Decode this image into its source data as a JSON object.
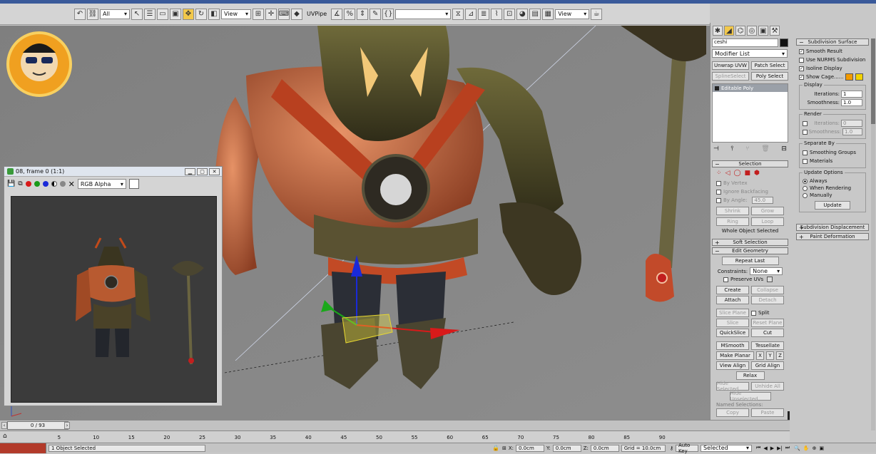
{
  "toolbar": {
    "filter_dropdown": "All",
    "refcoord_dropdown": "View",
    "uvpipe_label": "UVPipe",
    "view_dropdown": "View"
  },
  "render_window": {
    "title": "08, frame 0 (1:1)",
    "channel_dropdown": "RGB Alpha"
  },
  "command_panel": {
    "object_name": "ceshi",
    "modifier_list": "Modifier List",
    "buttons": {
      "unwrap_uvw": "Unwrap UVW",
      "patch_select": "Patch Select",
      "spline_select": "SplineSelect",
      "poly_select": "Poly Select"
    },
    "stack_item": "Editable Poly",
    "selection": {
      "header": "Selection",
      "by_vertex": "By Vertex",
      "ignore_backfacing": "Ignore Backfacing",
      "by_angle": "By Angle:",
      "angle_value": "45.0",
      "shrink": "Shrink",
      "grow": "Grow",
      "ring": "Ring",
      "loop": "Loop",
      "status": "Whole Object Selected"
    },
    "soft_selection": "Soft Selection",
    "edit_geometry": {
      "header": "Edit Geometry",
      "repeat_last": "Repeat Last",
      "constraints_label": "Constraints:",
      "constraints_value": "None",
      "preserve_uvs": "Preserve UVs",
      "create": "Create",
      "collapse": "Collapse",
      "attach": "Attach",
      "detach": "Detach",
      "slice_plane": "Slice Plane",
      "split": "Split",
      "slice": "Slice",
      "reset_plane": "Reset Plane",
      "quickslice": "QuickSlice",
      "cut": "Cut",
      "msmooth": "MSmooth",
      "tessellate": "Tessellate",
      "make_planar": "Make Planar",
      "x": "X",
      "y": "Y",
      "z": "Z",
      "view_align": "View Align",
      "grid_align": "Grid Align",
      "relax": "Relax",
      "hide_selected": "Hide Selected",
      "unhide_all": "Unhide All",
      "hide_unselected": "Hide Unselected",
      "named_selections": "Named Selections:",
      "copy": "Copy",
      "paste": "Paste"
    },
    "subdivision_surface": {
      "header": "Subdivision Surface",
      "smooth_result": "Smooth Result",
      "use_nurms": "Use NURMS Subdivision",
      "isoline_display": "Isoline Display",
      "show_cage": "Show Cage......",
      "display_group": "Display",
      "iterations_label": "Iterations:",
      "display_iterations": "1",
      "smoothness_label": "Smoothness:",
      "display_smoothness": "1.0",
      "render_group": "Render",
      "render_iterations": "0",
      "render_smoothness": "1.0",
      "separate_by": "Separate By",
      "smoothing_groups": "Smoothing Groups",
      "materials": "Materials",
      "update_options": "Update Options",
      "always": "Always",
      "when_rendering": "When Rendering",
      "manually": "Manually",
      "update": "Update"
    },
    "subdivision_displacement": "Subdivision Displacement",
    "paint_deformation": "Paint Deformation",
    "cage_colors": [
      "#f29a00",
      "#f2d200"
    ]
  },
  "timeline": {
    "frame_readout": "0 / 93",
    "ruler_ticks": [
      "5",
      "10",
      "15",
      "20",
      "25",
      "30",
      "35",
      "40",
      "45",
      "50",
      "55",
      "60",
      "65",
      "70",
      "75",
      "80",
      "85",
      "90"
    ],
    "progress": 0.0
  },
  "status_bar": {
    "selection_info": "1 Object Selected",
    "x_coord": "0.0cm",
    "y_coord": "0.0cm",
    "z_coord": "0.0cm",
    "grid": "Grid = 10.0cm",
    "auto_key": "Auto Key",
    "key_filter": "Selected"
  }
}
